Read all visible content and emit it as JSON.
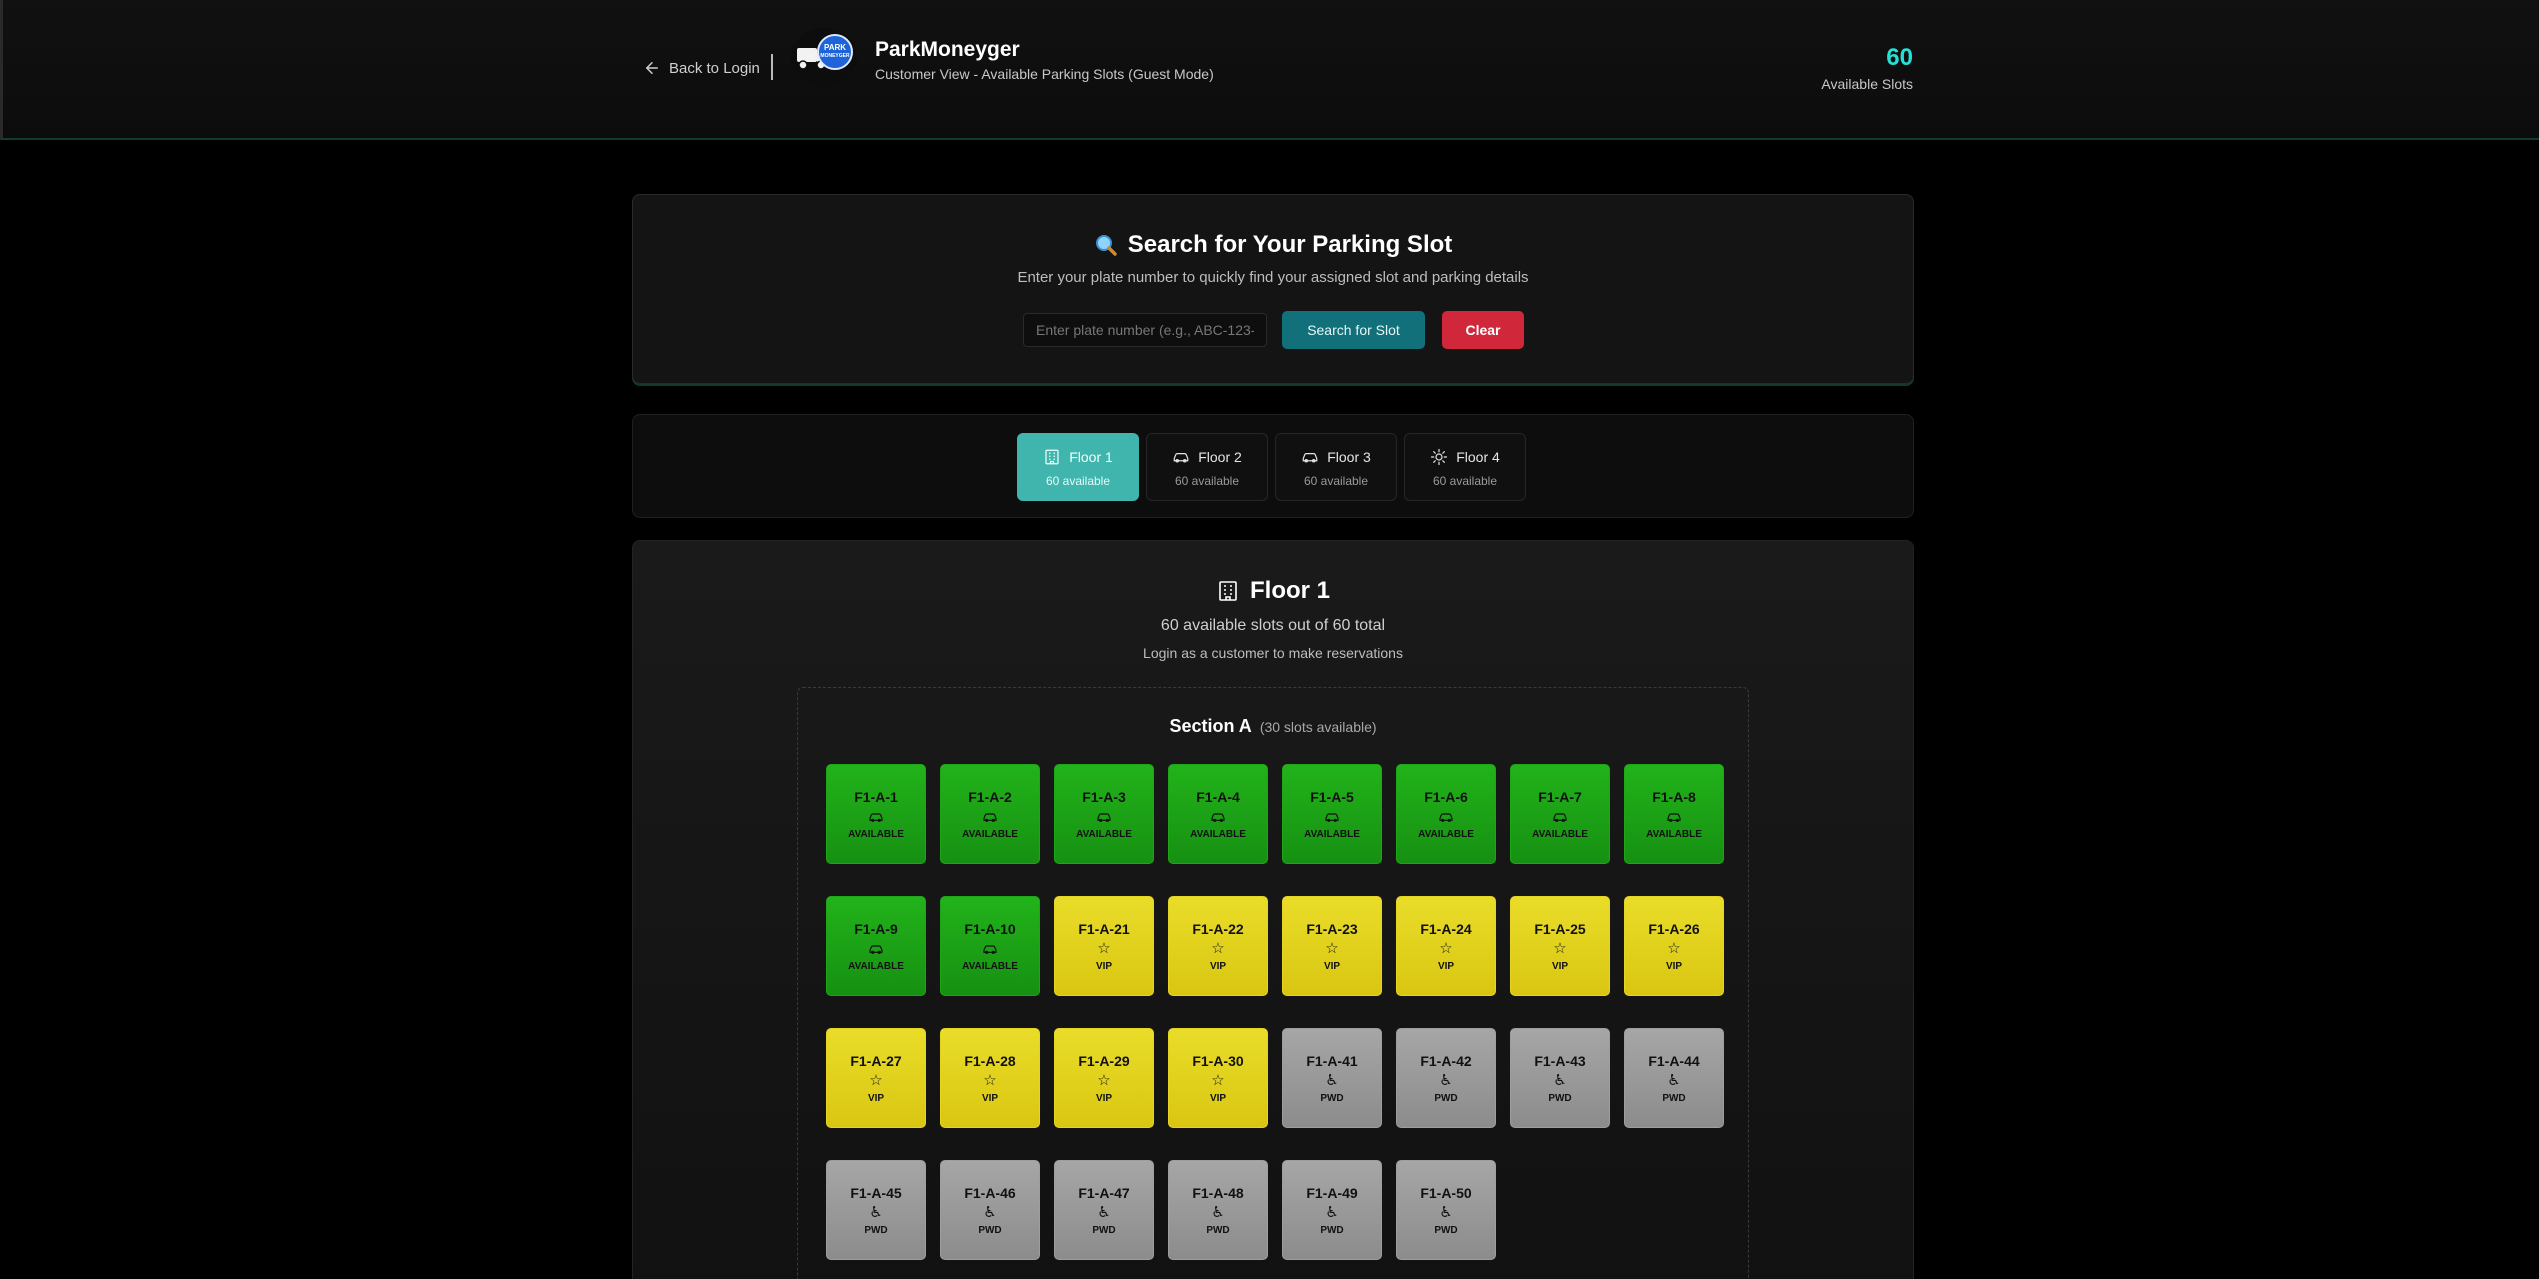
{
  "header": {
    "back_label": "Back to Login",
    "logo_badge_top": "PARK",
    "logo_badge_bottom": "MONEYGER",
    "brand": "ParkMoneyger",
    "subtitle": "Customer View - Available Parking Slots (Guest Mode)",
    "available_count": "60",
    "available_label": "Available Slots"
  },
  "search": {
    "title": "Search for Your Parking Slot",
    "description": "Enter your plate number to quickly find your assigned slot and parking details",
    "placeholder": "Enter plate number (e.g., ABC-123-",
    "value": "",
    "search_button": "Search for Slot",
    "clear_button": "Clear"
  },
  "floors": [
    {
      "label": "Floor 1",
      "sub": "60 available",
      "icon": "building-icon",
      "active": true
    },
    {
      "label": "Floor 2",
      "sub": "60 available",
      "icon": "car-icon",
      "active": false
    },
    {
      "label": "Floor 3",
      "sub": "60 available",
      "icon": "car-icon",
      "active": false
    },
    {
      "label": "Floor 4",
      "sub": "60 available",
      "icon": "sun-icon",
      "active": false
    }
  ],
  "floor_panel": {
    "title": "Floor 1",
    "stat": "60 available slots out of 60 total",
    "note": "Login as a customer to make reservations"
  },
  "section": {
    "name": "Section A",
    "count": "(30 slots available)"
  },
  "slots": [
    {
      "id": "F1-A-1",
      "status": "AVAILABLE",
      "type": "available"
    },
    {
      "id": "F1-A-2",
      "status": "AVAILABLE",
      "type": "available"
    },
    {
      "id": "F1-A-3",
      "status": "AVAILABLE",
      "type": "available"
    },
    {
      "id": "F1-A-4",
      "status": "AVAILABLE",
      "type": "available"
    },
    {
      "id": "F1-A-5",
      "status": "AVAILABLE",
      "type": "available"
    },
    {
      "id": "F1-A-6",
      "status": "AVAILABLE",
      "type": "available"
    },
    {
      "id": "F1-A-7",
      "status": "AVAILABLE",
      "type": "available"
    },
    {
      "id": "F1-A-8",
      "status": "AVAILABLE",
      "type": "available"
    },
    {
      "id": "F1-A-9",
      "status": "AVAILABLE",
      "type": "available"
    },
    {
      "id": "F1-A-10",
      "status": "AVAILABLE",
      "type": "available"
    },
    {
      "id": "F1-A-21",
      "status": "VIP",
      "type": "vip"
    },
    {
      "id": "F1-A-22",
      "status": "VIP",
      "type": "vip"
    },
    {
      "id": "F1-A-23",
      "status": "VIP",
      "type": "vip"
    },
    {
      "id": "F1-A-24",
      "status": "VIP",
      "type": "vip"
    },
    {
      "id": "F1-A-25",
      "status": "VIP",
      "type": "vip"
    },
    {
      "id": "F1-A-26",
      "status": "VIP",
      "type": "vip"
    },
    {
      "id": "F1-A-27",
      "status": "VIP",
      "type": "vip"
    },
    {
      "id": "F1-A-28",
      "status": "VIP",
      "type": "vip"
    },
    {
      "id": "F1-A-29",
      "status": "VIP",
      "type": "vip"
    },
    {
      "id": "F1-A-30",
      "status": "VIP",
      "type": "vip"
    },
    {
      "id": "F1-A-41",
      "status": "PWD",
      "type": "pwd"
    },
    {
      "id": "F1-A-42",
      "status": "PWD",
      "type": "pwd"
    },
    {
      "id": "F1-A-43",
      "status": "PWD",
      "type": "pwd"
    },
    {
      "id": "F1-A-44",
      "status": "PWD",
      "type": "pwd"
    },
    {
      "id": "F1-A-45",
      "status": "PWD",
      "type": "pwd"
    },
    {
      "id": "F1-A-46",
      "status": "PWD",
      "type": "pwd"
    },
    {
      "id": "F1-A-47",
      "status": "PWD",
      "type": "pwd"
    },
    {
      "id": "F1-A-48",
      "status": "PWD",
      "type": "pwd"
    },
    {
      "id": "F1-A-49",
      "status": "PWD",
      "type": "pwd"
    },
    {
      "id": "F1-A-50",
      "status": "PWD",
      "type": "pwd"
    }
  ],
  "colors": {
    "accent": "#25e0d5",
    "active_tab": "#3fb5ad",
    "search_button": "#11707a",
    "clear_button": "#d0273a",
    "available": "#1fa518",
    "vip": "#e5d520",
    "pwd": "#9e9e9e"
  }
}
